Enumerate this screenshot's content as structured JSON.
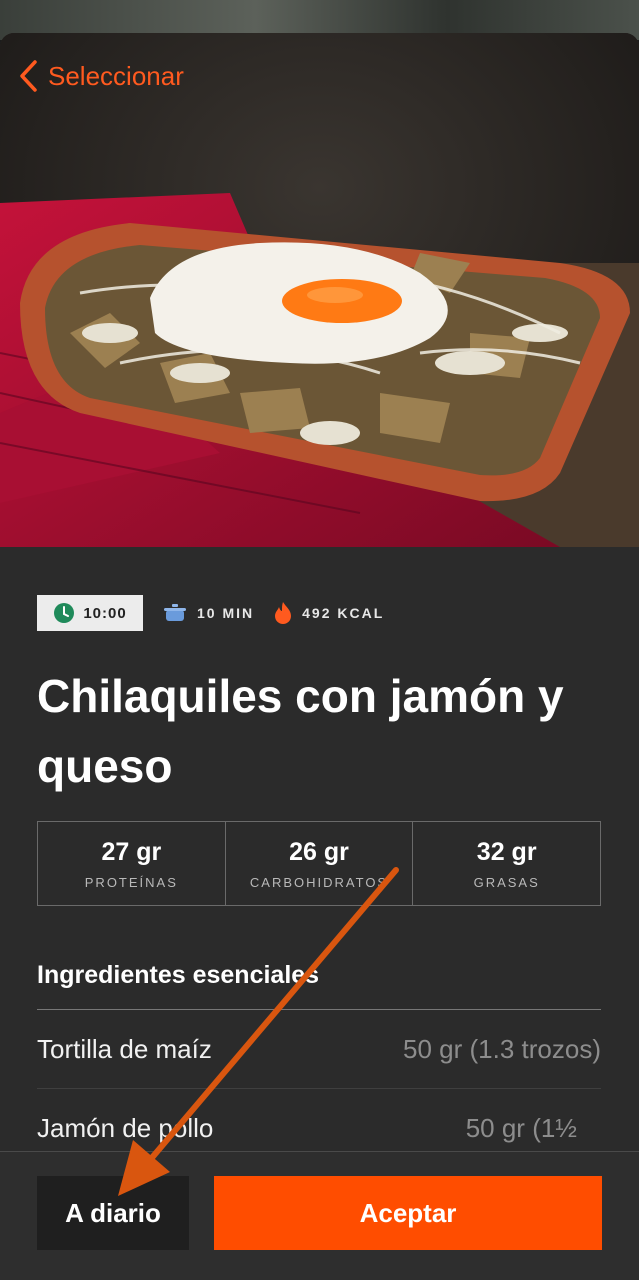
{
  "nav": {
    "back_label": "Seleccionar"
  },
  "recipe": {
    "time_chip": "10:00",
    "prep_time": "10 MIN",
    "calories": "492 KCAL",
    "title": "Chilaquiles con jamón y queso"
  },
  "macros": [
    {
      "value": "27 gr",
      "label": "PROTEÍNAS"
    },
    {
      "value": "26 gr",
      "label": "CARBOHIDRATOS"
    },
    {
      "value": "32 gr",
      "label": "GRASAS"
    }
  ],
  "ingredients": {
    "title": "Ingredientes esenciales",
    "items": [
      {
        "name": "Tortilla de maíz",
        "qty": "50 gr (1.3 trozos)"
      },
      {
        "name": "Jamón de pollo",
        "qty": "50 gr (1½"
      }
    ]
  },
  "footer": {
    "diario_label": "A diario",
    "accept_label": "Aceptar"
  },
  "colors": {
    "accent": "#ff4d00",
    "back_text": "#ff5a1f",
    "arrow": "#d9560f"
  },
  "icons": [
    "chevron-left-icon",
    "clock-icon",
    "pot-icon",
    "flame-icon"
  ]
}
